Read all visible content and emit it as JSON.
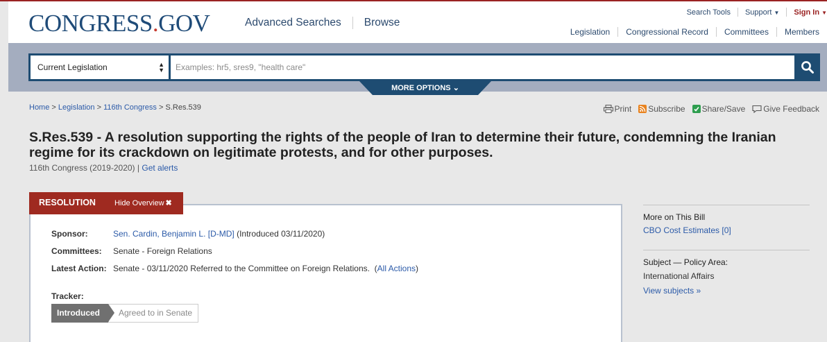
{
  "colors": {
    "brand_navy": "#1e4c72",
    "brand_red": "#9f2a20",
    "search_band": "#a4adbf",
    "link": "#2b5aa8"
  },
  "logo": {
    "main": "CONGRESS",
    "dot": ".",
    "tld": "GOV"
  },
  "main_nav": [
    "Advanced Searches",
    "Browse"
  ],
  "utility_nav": {
    "search_tools": "Search Tools",
    "support": "Support",
    "sign_in": "Sign In"
  },
  "sub_nav": [
    "Legislation",
    "Congressional Record",
    "Committees",
    "Members"
  ],
  "search": {
    "scope_selected": "Current Legislation",
    "placeholder": "Examples: hr5, sres9, \"health care\"",
    "value": "",
    "submit_icon": "search-icon",
    "more_options": "MORE OPTIONS"
  },
  "breadcrumb": {
    "home": "Home",
    "legislation": "Legislation",
    "congress": "116th Congress",
    "sep": ">",
    "current": "S.Res.539"
  },
  "page_tools": {
    "print": "Print",
    "subscribe": "Subscribe",
    "share": "Share/Save",
    "feedback": "Give Feedback"
  },
  "bill": {
    "title": "S.Res.539 - A resolution supporting the rights of the people of Iran to determine their future, condemning the Iranian regime for its crackdown on legitimate protests, and for other purposes.",
    "congress": "116th Congress (2019-2020)",
    "alerts_sep": "|",
    "get_alerts": "Get alerts"
  },
  "overview": {
    "type_label": "RESOLUTION",
    "hide_label": "Hide Overview",
    "sponsor_label": "Sponsor:",
    "sponsor_name": "Sen. Cardin, Benjamin L. [D-MD]",
    "sponsor_intro": "(Introduced 03/11/2020)",
    "committees_label": "Committees:",
    "committees_value": "Senate - Foreign Relations",
    "latest_action_label": "Latest Action:",
    "latest_action_value": "Senate - 03/11/2020 Referred to the Committee on Foreign Relations.",
    "all_actions": "All Actions",
    "tracker_label": "Tracker:",
    "tracker_steps": [
      "Introduced",
      "Agreed to in Senate"
    ],
    "tracker_current_step": 1
  },
  "sidebar": {
    "more_heading": "More on This Bill",
    "cbo_link": "CBO Cost Estimates [0]",
    "subject_heading": "Subject — Policy Area:",
    "policy_area": "International Affairs",
    "view_subjects": "View subjects »"
  }
}
